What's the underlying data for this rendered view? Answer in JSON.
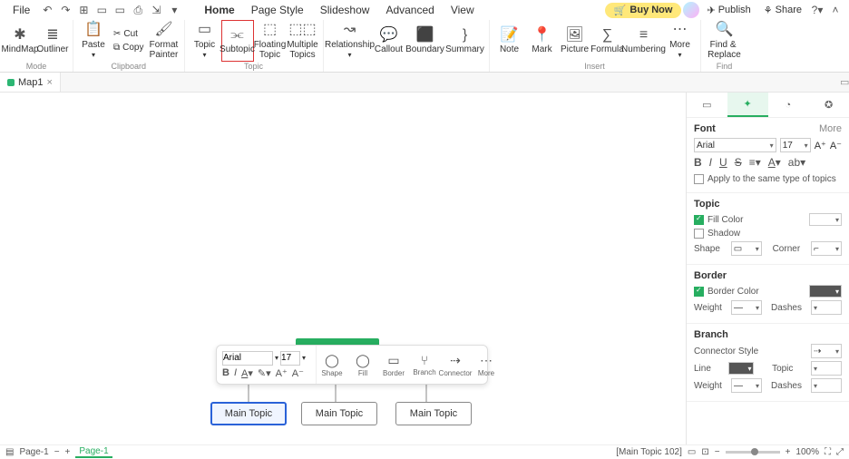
{
  "menu": {
    "file": "File",
    "tabs": [
      "Home",
      "Page Style",
      "Slideshow",
      "Advanced",
      "View"
    ],
    "active_tab": "Home",
    "buy_now": "Buy Now",
    "publish": "Publish",
    "share": "Share"
  },
  "ribbon": {
    "views": {
      "mindmap": "MindMap",
      "outliner": "Outliner",
      "group": "Mode"
    },
    "clipboard": {
      "paste": "Paste",
      "cut": "Cut",
      "copy": "Copy",
      "fmt_painter": "Format\nPainter",
      "group": "Clipboard"
    },
    "topic_group": {
      "topic": "Topic",
      "subtopic": "Subtopic",
      "floating": "Floating\nTopic",
      "multiple": "Multiple\nTopics",
      "group": "Topic"
    },
    "relations": {
      "relationship": "Relationship",
      "callout": "Callout",
      "boundary": "Boundary",
      "summary": "Summary"
    },
    "insert": {
      "note": "Note",
      "mark": "Mark",
      "picture": "Picture",
      "formula": "Formula",
      "numbering": "Numbering",
      "more": "More",
      "group": "Insert"
    },
    "find": {
      "find_replace": "Find & \nReplace",
      "group": "Find"
    }
  },
  "doc_tabs": {
    "name": "Map1"
  },
  "canvas": {
    "children": [
      "Main Topic",
      "Main Topic",
      "Main Topic"
    ]
  },
  "float_toolbar": {
    "font": "Arial",
    "size": "17",
    "labels": {
      "shape": "Shape",
      "fill": "Fill",
      "border": "Border",
      "branch": "Branch",
      "connector": "Connector",
      "more": "More"
    }
  },
  "side": {
    "font": {
      "title": "Font",
      "more": "More",
      "name": "Arial",
      "size": "17",
      "apply_same": "Apply to the same type of topics"
    },
    "topic": {
      "title": "Topic",
      "fill_color": "Fill Color",
      "shadow": "Shadow",
      "shape": "Shape",
      "corner": "Corner"
    },
    "border": {
      "title": "Border",
      "border_color": "Border Color",
      "weight": "Weight",
      "dashes": "Dashes"
    },
    "branch": {
      "title": "Branch",
      "connector_style": "Connector Style",
      "line": "Line",
      "topic": "Topic",
      "weight": "Weight",
      "dashes": "Dashes"
    }
  },
  "status": {
    "page_label": "Page-1",
    "tab_label": "Page-1",
    "hover": "[Main Topic 102]",
    "zoom": "100%"
  }
}
